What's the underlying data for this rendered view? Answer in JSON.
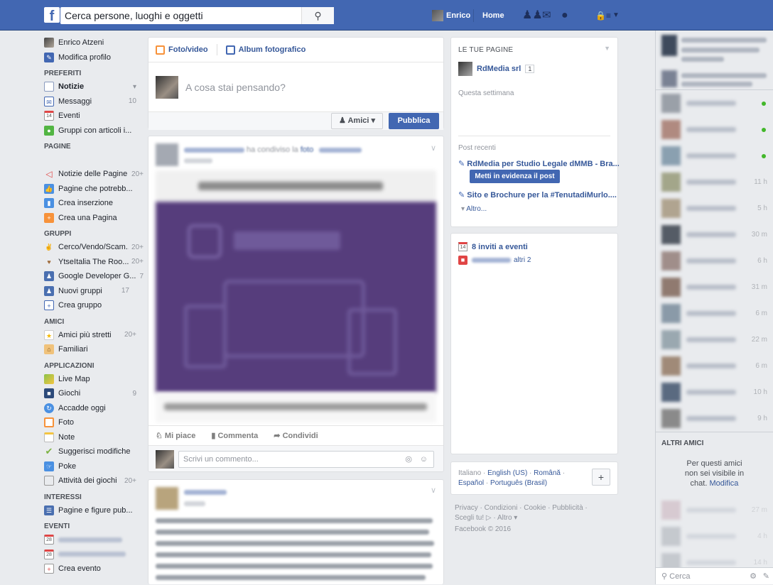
{
  "topbar": {
    "search_placeholder": "Cerca persone, luoghi e oggetti",
    "user_name": "Enrico",
    "home_label": "Home"
  },
  "left_nav": {
    "profile_name": "Enrico Atzeni",
    "edit_profile": "Modifica profilo",
    "favorites_header": "PREFERITI",
    "favorites": [
      {
        "label": "Notizie",
        "count": ""
      },
      {
        "label": "Messaggi",
        "count": "10"
      },
      {
        "label": "Eventi",
        "count": ""
      },
      {
        "label": "Gruppi con articoli i...",
        "count": ""
      }
    ],
    "pages_header": "PAGINE",
    "pages": [
      {
        "label": "Notizie delle Pagine",
        "count": "20+"
      },
      {
        "label": "Pagine che potrebb...",
        "count": ""
      },
      {
        "label": "Crea inserzione",
        "count": ""
      },
      {
        "label": "Crea una Pagina",
        "count": ""
      }
    ],
    "groups_header": "GRUPPI",
    "groups": [
      {
        "label": "Cerco/Vendo/Scam...",
        "count": "20+"
      },
      {
        "label": "YtseItalia The Roo...",
        "count": "20+"
      },
      {
        "label": "Google Developer G...",
        "count": "7"
      },
      {
        "label": "Nuovi gruppi",
        "count": "17"
      },
      {
        "label": "Crea gruppo",
        "count": ""
      }
    ],
    "friends_header": "AMICI",
    "friends": [
      {
        "label": "Amici più stretti",
        "count": "20+"
      },
      {
        "label": "Familiari",
        "count": ""
      }
    ],
    "apps_header": "APPLICAZIONI",
    "apps": [
      {
        "label": "Live Map",
        "count": ""
      },
      {
        "label": "Giochi",
        "count": "9"
      },
      {
        "label": "Accadde oggi",
        "count": ""
      },
      {
        "label": "Foto",
        "count": ""
      },
      {
        "label": "Note",
        "count": ""
      },
      {
        "label": "Suggerisci modifiche",
        "count": ""
      },
      {
        "label": "Poke",
        "count": ""
      },
      {
        "label": "Attività dei giochi",
        "count": "20+"
      }
    ],
    "interests_header": "INTERESSI",
    "interests": [
      {
        "label": "Pagine e figure pub...",
        "count": ""
      }
    ],
    "events_header": "EVENTI",
    "event_day_1": "28",
    "event_day_2": "28",
    "create_event": "Crea evento"
  },
  "composer": {
    "tab_photo": "Foto/video",
    "tab_album": "Album fotografico",
    "placeholder": "A cosa stai pensando?",
    "audience": "Amici",
    "publish": "Pubblica"
  },
  "post1": {
    "shared_text": "ha condiviso la",
    "shared_link": "foto",
    "like": "Mi piace",
    "comment": "Commenta",
    "share": "Condividi",
    "comment_placeholder": "Scrivi un commento..."
  },
  "pages_widget": {
    "header": "LE TUE PAGINE",
    "page_name": "RdMedia srl",
    "page_badge": "1",
    "this_week": "Questa settimana",
    "recent_posts": "Post recenti",
    "post_1": "RdMedia per Studio Legale dMMB - Bra...",
    "boost": "Metti in evidenza il post",
    "post_2": "Sito e Brochure per la #TenutadiMurlo....",
    "more": "Altro..."
  },
  "events_widget": {
    "day": "14",
    "invites": "8 inviti a eventi",
    "others": "altri 2"
  },
  "languages": {
    "line1": [
      "Italiano",
      "English (US)",
      "Română"
    ],
    "line2": [
      "Español",
      "Português (Brasil)"
    ],
    "add": "+"
  },
  "footer": {
    "links1": "Privacy · Condizioni · Cookie · Pubblicità ·",
    "links2": "Scegli tu!",
    "links3": "· Altro ▾",
    "copyright": "Facebook © 2016"
  },
  "chat": {
    "times": [
      "",
      "",
      "",
      "11 h",
      "5 h",
      "30 m",
      "6 h",
      "31 m",
      "6 m",
      "22 m",
      "6 m",
      "10 h",
      "9 h"
    ],
    "other_friends_header": "ALTRI AMICI",
    "other_friends_note": "Per questi amici non sei visibile in chat.",
    "other_friends_link": "Modifica",
    "other_times": [
      "27 m",
      "4 h",
      "14 h"
    ],
    "search_placeholder": "Cerca"
  },
  "colors": {
    "brand_blue": "#4267b2",
    "link_blue": "#365899",
    "online_green": "#42b72a",
    "background": "#e9ebee"
  }
}
